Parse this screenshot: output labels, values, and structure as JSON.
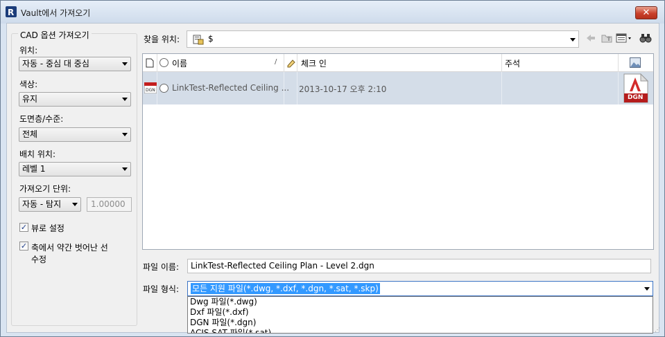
{
  "window": {
    "title": "Vault에서 가져오기",
    "close_glyph": "✕"
  },
  "left": {
    "group_title": "CAD 옵션 가져오기",
    "position": {
      "label": "위치:",
      "value": "자동 - 중심 대 중심"
    },
    "color": {
      "label": "색상:",
      "value": "유지"
    },
    "layers": {
      "label": "도면층/수준:",
      "value": "전체"
    },
    "placement": {
      "label": "배치 위치:",
      "value": "레벨 1"
    },
    "units": {
      "label": "가져오기 단위:",
      "value": "자동 - 탐지",
      "scale": "1.00000"
    },
    "orient_view": {
      "label": "뷰로 설정",
      "checked": true
    },
    "correct_lines": {
      "label": "축에서 약간 벗어난 선",
      "label2": "수정",
      "checked": true
    }
  },
  "lookin": {
    "label": "찾을 위치:",
    "value": "$"
  },
  "toolbar": {
    "icons": [
      "back-icon",
      "up-folder-icon",
      "views-menu-icon",
      "find-icon"
    ]
  },
  "list": {
    "columns": {
      "name": "이름",
      "checkin": "체크 인",
      "comment": "주석"
    },
    "rows": [
      {
        "name": "LinkTest-Reflected Ceiling ...",
        "checkin": "2013-10-17 오후 2:10",
        "comment": "",
        "badge": "DGN"
      }
    ]
  },
  "filename": {
    "label": "파일 이름:",
    "value": "LinkTest-Reflected Ceiling Plan - Level 2.dgn"
  },
  "filetype": {
    "label": "파일 형식:",
    "value": "모든 지원 파일(*.dwg, *.dxf, *.dgn, *.sat, *.skp)",
    "options": [
      "Dwg 파일(*.dwg)",
      "Dxf 파일(*.dxf)",
      "DGN 파일(*.dgn)",
      "ACIS SAT 파일(*.sat)"
    ]
  },
  "colors": {
    "selection_row": "#d4dde8",
    "accent": "#3399ff",
    "close": "#c9412b"
  }
}
